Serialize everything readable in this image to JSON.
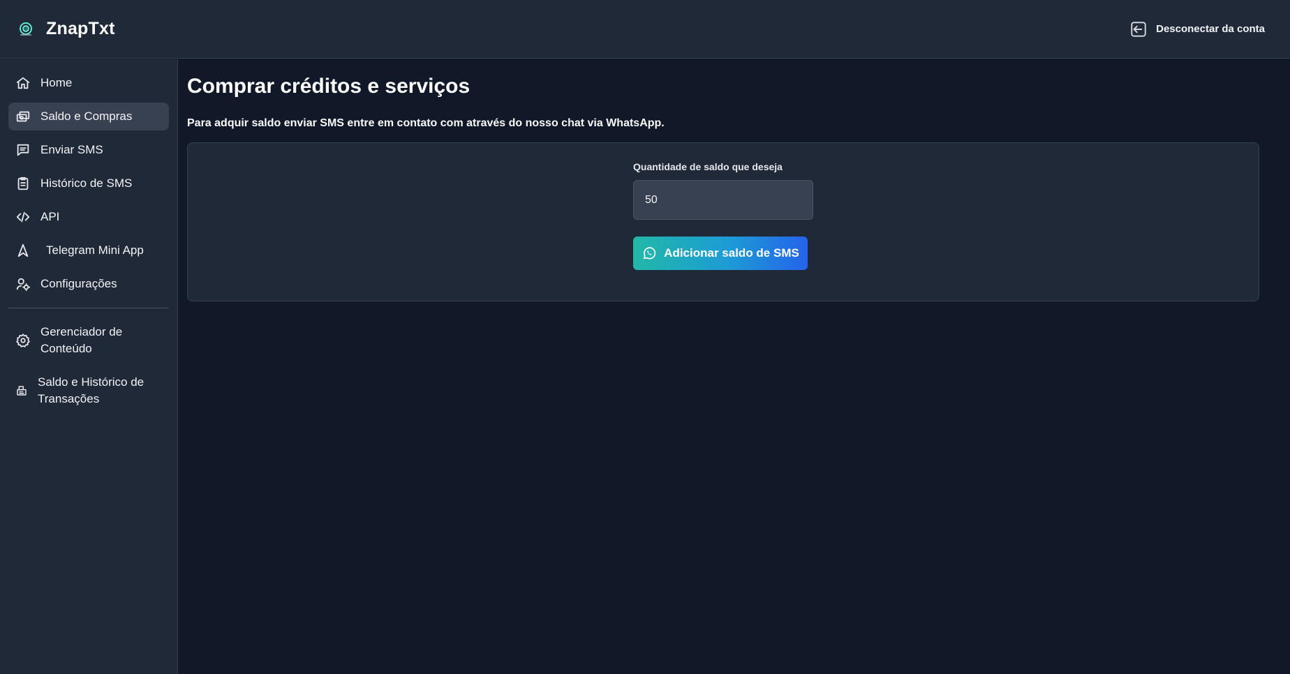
{
  "header": {
    "brand_name": "ZnapTxt",
    "logout_label": "Desconectar da conta"
  },
  "sidebar": {
    "items": [
      {
        "label": "Home",
        "icon": "home-icon"
      },
      {
        "label": "Saldo e Compras",
        "icon": "wallet-icon",
        "active": true
      },
      {
        "label": "Enviar SMS",
        "icon": "message-icon"
      },
      {
        "label": "Histórico de SMS",
        "icon": "clipboard-icon"
      },
      {
        "label": "API",
        "icon": "code-icon"
      },
      {
        "label": "Telegram Mini App",
        "icon": "navigation-icon"
      },
      {
        "label": "Configurações",
        "icon": "user-gear-icon"
      }
    ],
    "admin_items": [
      {
        "line1": "Gerenciador de",
        "line2": "Conteúdo",
        "icon": "gear-icon"
      },
      {
        "line1": "Saldo e Histórico de",
        "line2": "Transações",
        "icon": "cash-register-icon"
      }
    ]
  },
  "main": {
    "title": "Comprar créditos e serviços",
    "description": "Para adquir saldo enviar SMS entre em contato com através do nosso chat via WhatsApp.",
    "form": {
      "label": "Quantidade de saldo que deseja",
      "value": "50",
      "button_label": "Adicionar saldo de SMS",
      "button_icon": "whatsapp-icon"
    }
  },
  "colors": {
    "background": "#111827",
    "panel": "#1f2937",
    "active_item": "#374151",
    "button_gradient_start": "#22b8a7",
    "button_gradient_end": "#2563eb"
  }
}
